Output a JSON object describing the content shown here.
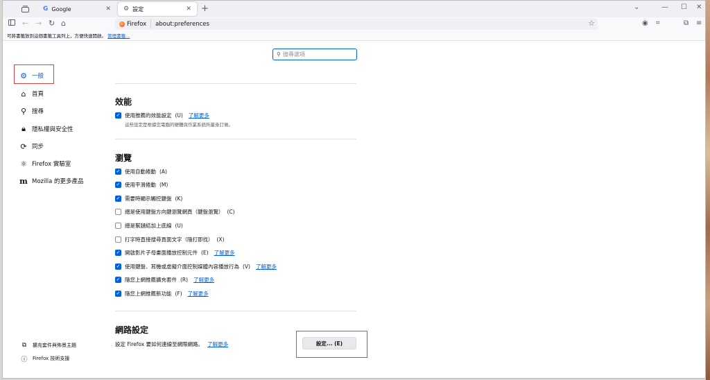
{
  "tabs": [
    {
      "label": "Google",
      "icon": "google-favicon"
    },
    {
      "label": "設定",
      "icon": "gear-icon"
    }
  ],
  "navbar": {
    "identity_label": "Firefox",
    "url": "about:preferences"
  },
  "bookmarks_bar": {
    "text": "可將書籤放到這個書籤工具列上，方便快速開啟。",
    "link": "管理書籤..."
  },
  "search": {
    "placeholder": "搜尋選項"
  },
  "sidebar": {
    "items": [
      {
        "label": "一般",
        "icon": "gear-icon"
      },
      {
        "label": "首頁",
        "icon": "home-icon"
      },
      {
        "label": "搜尋",
        "icon": "search-icon"
      },
      {
        "label": "隱私權與安全性",
        "icon": "lock-icon"
      },
      {
        "label": "同步",
        "icon": "sync-icon"
      },
      {
        "label": "Firefox 實驗室",
        "icon": "labs-icon"
      },
      {
        "label": "Mozilla 的更多產品",
        "icon": "mozilla-icon"
      }
    ],
    "footer": [
      {
        "label": "擴充套件與佈景主題",
        "icon": "extensions-icon"
      },
      {
        "label": "Firefox 技術支援",
        "icon": "help-icon"
      }
    ]
  },
  "performance": {
    "title": "效能",
    "items": [
      {
        "label": "使用推薦的效能設定",
        "key": "(U)",
        "checked": true,
        "learn_more": "了解更多"
      }
    ],
    "note": "這些設定是根據您電腦的硬體與作業系統所量身訂做。"
  },
  "browsing": {
    "title": "瀏覽",
    "items": [
      {
        "label": "使用自動捲動",
        "key": "(A)",
        "checked": true,
        "learn_more": ""
      },
      {
        "label": "使用平滑捲動",
        "key": "(M)",
        "checked": true,
        "learn_more": ""
      },
      {
        "label": "需要時顯示觸控鍵盤",
        "key": "(K)",
        "checked": true,
        "learn_more": ""
      },
      {
        "label": "總是使用鍵盤方向鍵瀏覽網頁（鍵盤瀏覽）",
        "key": "(C)",
        "checked": false,
        "learn_more": ""
      },
      {
        "label": "總是幫鏈結加上底線",
        "key": "(U)",
        "checked": false,
        "learn_more": ""
      },
      {
        "label": "打字時直接搜尋頁面文字（隨打即找）",
        "key": "(X)",
        "checked": false,
        "learn_more": ""
      },
      {
        "label": "開啟影片子母畫面播放控制元件",
        "key": "(E)",
        "checked": true,
        "learn_more": "了解更多"
      },
      {
        "label": "使用鍵盤、耳機或虛擬介面控制媒體內容播放行為",
        "key": "(V)",
        "checked": true,
        "learn_more": "了解更多"
      },
      {
        "label": "隨您上網推薦擴充套件",
        "key": "(R)",
        "checked": true,
        "learn_more": "了解更多"
      },
      {
        "label": "隨您上網推薦新功能",
        "key": "(F)",
        "checked": true,
        "learn_more": "了解更多"
      }
    ]
  },
  "network": {
    "title": "網路設定",
    "description": "設定 Firefox 要如何連線至網際網路。",
    "learn_more": "了解更多",
    "button": "設定... (E)"
  },
  "colors": {
    "accent": "#0061e0",
    "highlight_box": "#e04040"
  }
}
